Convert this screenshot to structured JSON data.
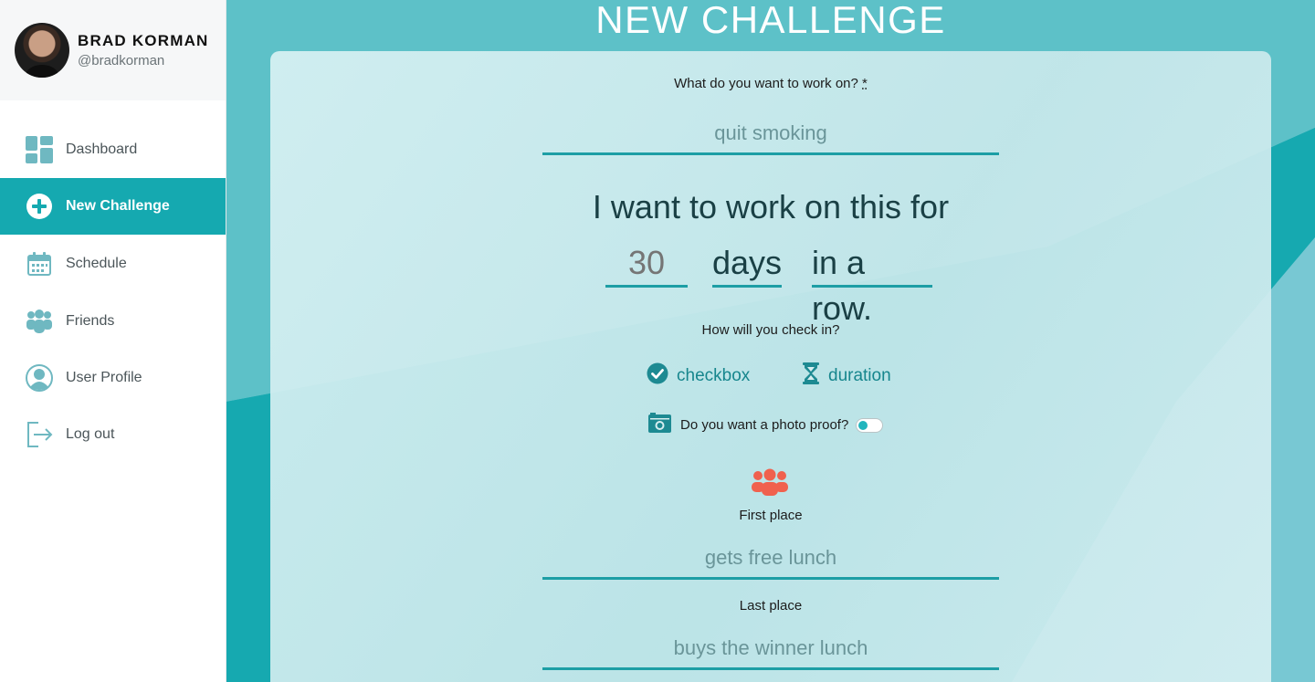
{
  "user": {
    "name": "BRAD KORMAN",
    "handle": "@bradkorman"
  },
  "nav": [
    {
      "label": "Dashboard",
      "icon": "dashboard-grid-icon"
    },
    {
      "label": "New Challenge",
      "icon": "plus-circle-icon",
      "active": true
    },
    {
      "label": "Schedule",
      "icon": "calendar-icon"
    },
    {
      "label": "Friends",
      "icon": "group-icon"
    },
    {
      "label": "User Profile",
      "icon": "user-circle-icon"
    },
    {
      "label": "Log out",
      "icon": "logout-icon"
    }
  ],
  "page": {
    "title": "NEW CHALLENGE"
  },
  "form": {
    "goal_label": "What do you want to work on?",
    "goal_required_mark": "*",
    "goal_placeholder": "quit smoking",
    "sentence_start": "I want to work on this for",
    "duration_placeholder": "30",
    "duration_unit": "days",
    "frequency": "in a row.",
    "checkin_label": "How will you check in?",
    "checkin_options": [
      {
        "label": "checkbox",
        "icon": "check-circle-icon"
      },
      {
        "label": "duration",
        "icon": "hourglass-icon"
      }
    ],
    "photo_label": "Do you want a photo proof?",
    "photo_proof_enabled": false,
    "first_place_label": "First place",
    "first_place_placeholder": "gets free lunch",
    "last_place_label": "Last place",
    "last_place_placeholder": "buys the winner lunch"
  },
  "colors": {
    "accent": "#15a9b0",
    "underline": "#1d9ea5",
    "icon_accent": "#1d8a92",
    "group_icon": "#f0614e"
  }
}
